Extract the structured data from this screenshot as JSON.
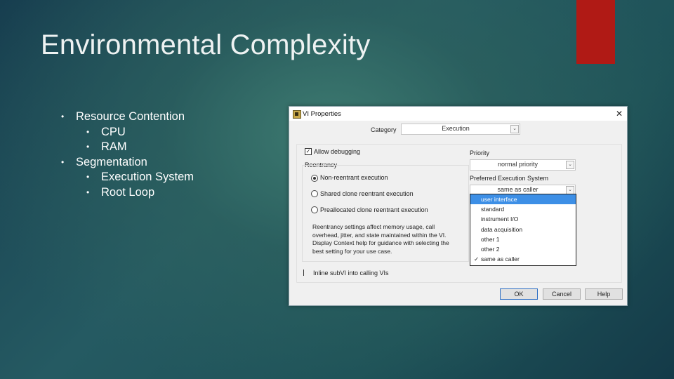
{
  "slide": {
    "title": "Environmental Complexity",
    "accent_color": "#b01a15",
    "bullets": [
      {
        "level": 1,
        "text": "Resource Contention"
      },
      {
        "level": 2,
        "text": "CPU"
      },
      {
        "level": 2,
        "text": "RAM"
      },
      {
        "level": 1,
        "text": "Segmentation"
      },
      {
        "level": 2,
        "text": "Execution System"
      },
      {
        "level": 2,
        "text": "Root Loop"
      }
    ],
    "bullet_glyph": "•"
  },
  "dialog": {
    "title": "VI Properties",
    "close_glyph": "✕",
    "category_label": "Category",
    "category_value": "Execution",
    "allow_debugging": {
      "label": "Allow debugging",
      "checked": true,
      "glyph": "✓"
    },
    "reentrancy": {
      "label": "Reentrancy",
      "options": [
        {
          "label": "Non-reentrant execution",
          "selected": true
        },
        {
          "label": "Shared clone reentrant execution",
          "selected": false
        },
        {
          "label": "Preallocated clone reentrant execution",
          "selected": false
        }
      ],
      "description": "Reentrancy settings affect memory usage, call overhead, jitter, and state maintained within the VI. Display Context help for guidance with selecting the best setting for your use case."
    },
    "priority": {
      "label": "Priority",
      "value": "normal priority"
    },
    "execution_system": {
      "label": "Preferred Execution System",
      "value": "same as caller",
      "options": [
        {
          "label": "user interface",
          "highlighted": true,
          "checked": false
        },
        {
          "label": "standard",
          "highlighted": false,
          "checked": false
        },
        {
          "label": "instrument I/O",
          "highlighted": false,
          "checked": false
        },
        {
          "label": "data acquisition",
          "highlighted": false,
          "checked": false
        },
        {
          "label": "other 1",
          "highlighted": false,
          "checked": false
        },
        {
          "label": "other 2",
          "highlighted": false,
          "checked": false
        },
        {
          "label": "same as caller",
          "highlighted": false,
          "checked": true
        }
      ],
      "check_glyph": "✓"
    },
    "inline_subvi": {
      "label": "Inline subVI into calling VIs",
      "checked": false
    },
    "buttons": {
      "ok": "OK",
      "cancel": "Cancel",
      "help": "Help"
    },
    "dropdown_arrow": "⌄"
  }
}
